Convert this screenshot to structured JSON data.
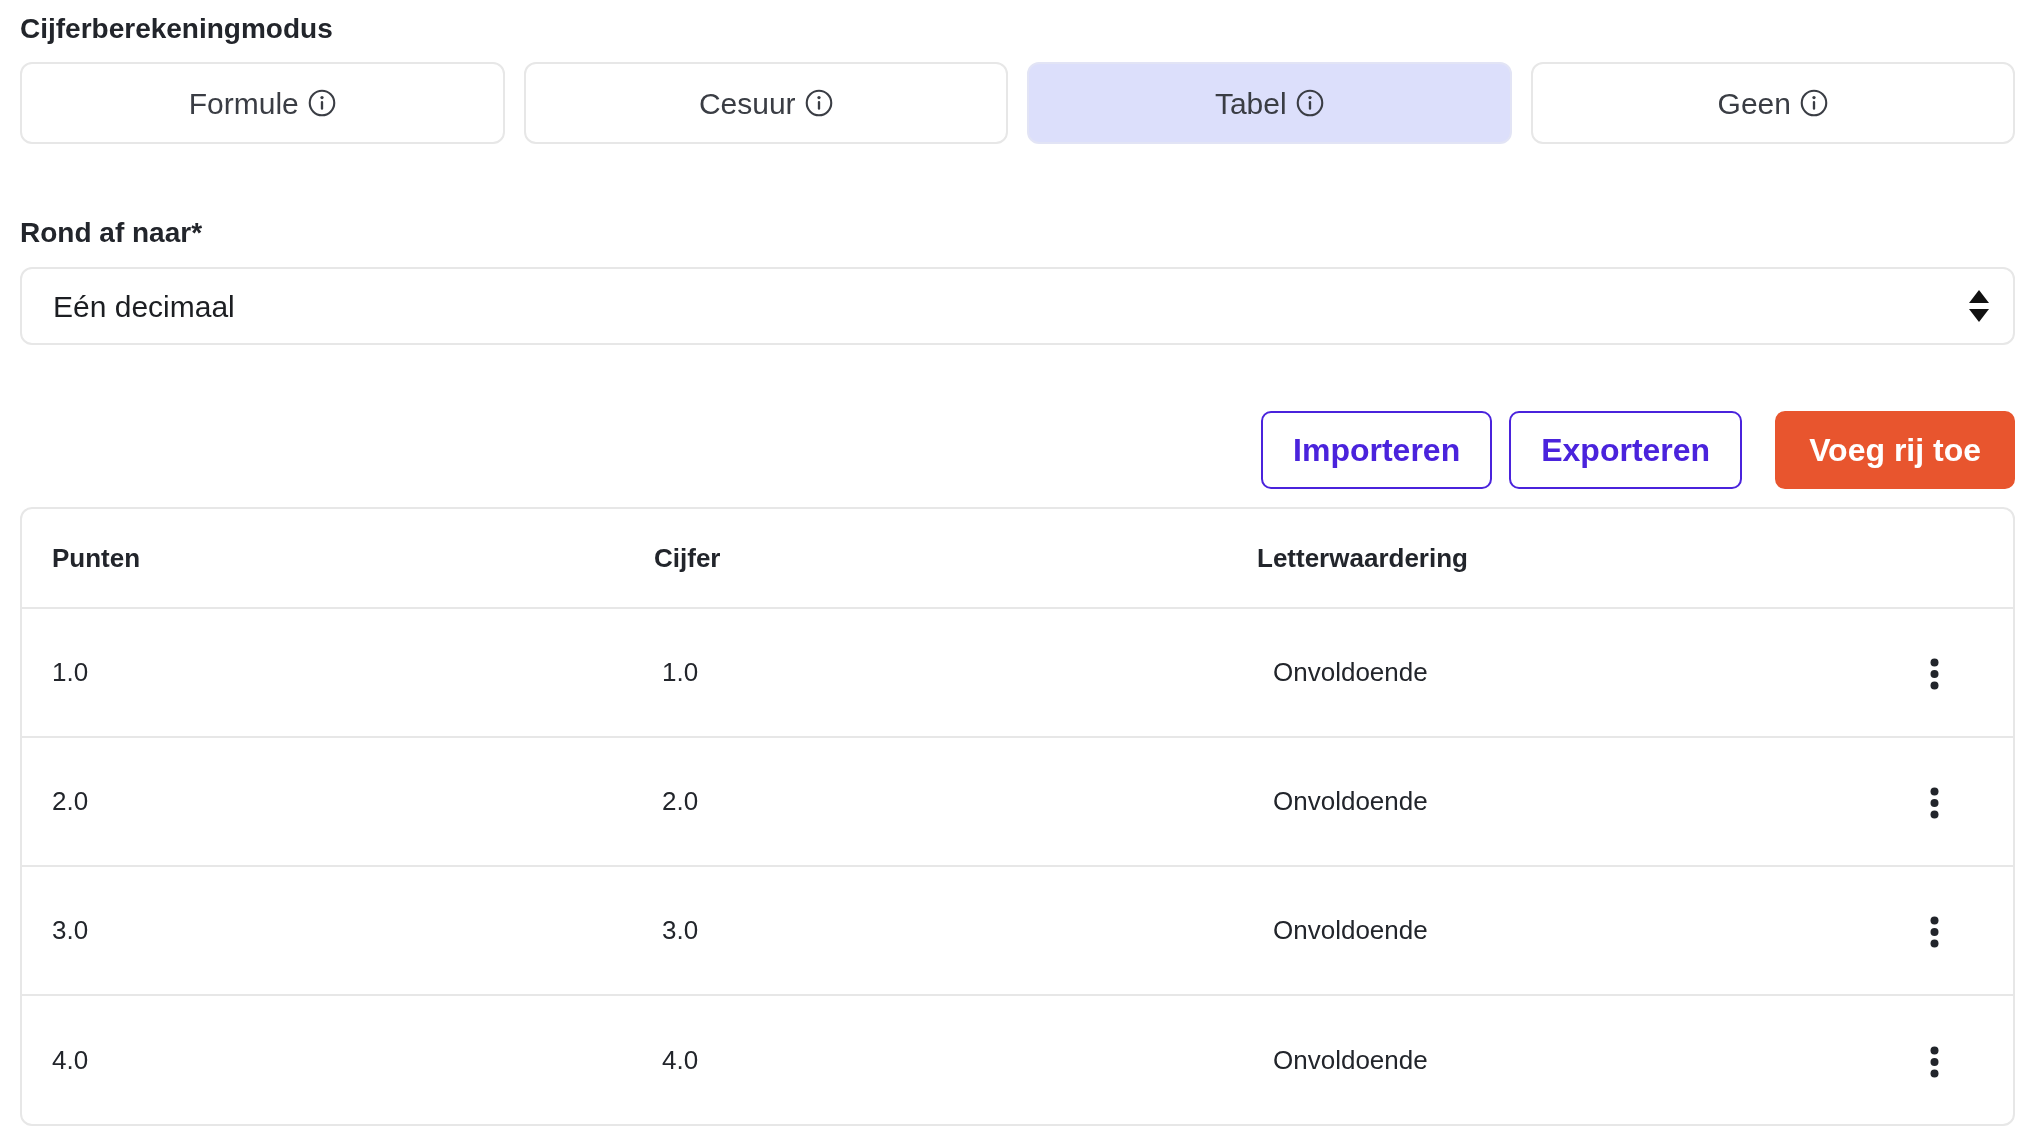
{
  "mode_section": {
    "title": "Cijferberekeningmodus",
    "options": [
      {
        "label": "Formule",
        "selected": false
      },
      {
        "label": "Cesuur",
        "selected": false
      },
      {
        "label": "Tabel",
        "selected": true
      },
      {
        "label": "Geen",
        "selected": false
      }
    ]
  },
  "rounding": {
    "label": "Rond af naar*",
    "value": "Eén decimaal"
  },
  "actions": [
    {
      "label": "Importeren",
      "kind": "outline"
    },
    {
      "label": "Exporteren",
      "kind": "outline"
    },
    {
      "label": "Voeg rij toe",
      "kind": "primary"
    }
  ],
  "table": {
    "columns": [
      "Punten",
      "Cijfer",
      "Letterwaardering"
    ],
    "rows": [
      {
        "cells": [
          "1.0",
          "1.0",
          "Onvoldoende"
        ]
      },
      {
        "cells": [
          "2.0",
          "2.0",
          "Onvoldoende"
        ]
      },
      {
        "cells": [
          "3.0",
          "3.0",
          "Onvoldoende"
        ]
      },
      {
        "cells": [
          "4.0",
          "4.0",
          "Onvoldoende"
        ]
      }
    ]
  }
}
